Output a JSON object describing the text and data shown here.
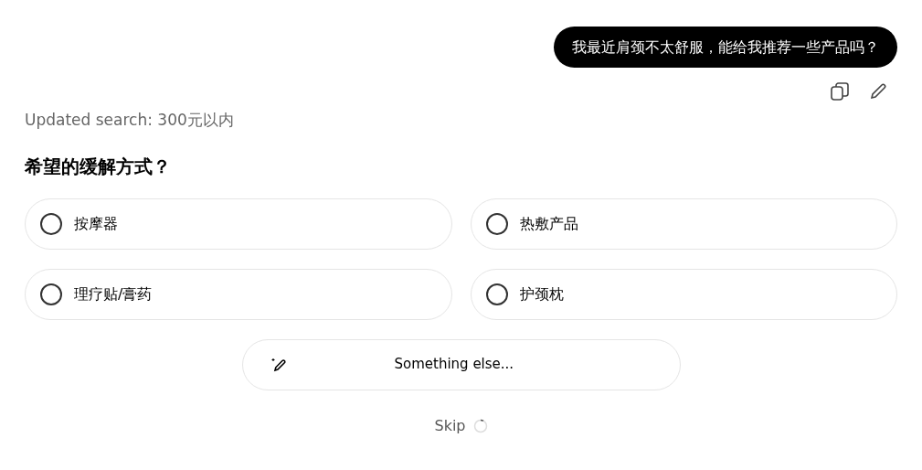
{
  "user_message": {
    "text": "我最近肩颈不太舒服，能给我推荐一些产品吗？"
  },
  "status": "Updated search: 300元以内",
  "question": "希望的缓解方式？",
  "options": [
    {
      "label": "按摩器",
      "selected": false
    },
    {
      "label": "热敷产品",
      "selected": false
    },
    {
      "label": "理疗贴/膏药",
      "selected": false
    },
    {
      "label": "护颈枕",
      "selected": false
    }
  ],
  "other_option": {
    "label": "Something else..."
  },
  "skip": {
    "label": "Skip"
  }
}
